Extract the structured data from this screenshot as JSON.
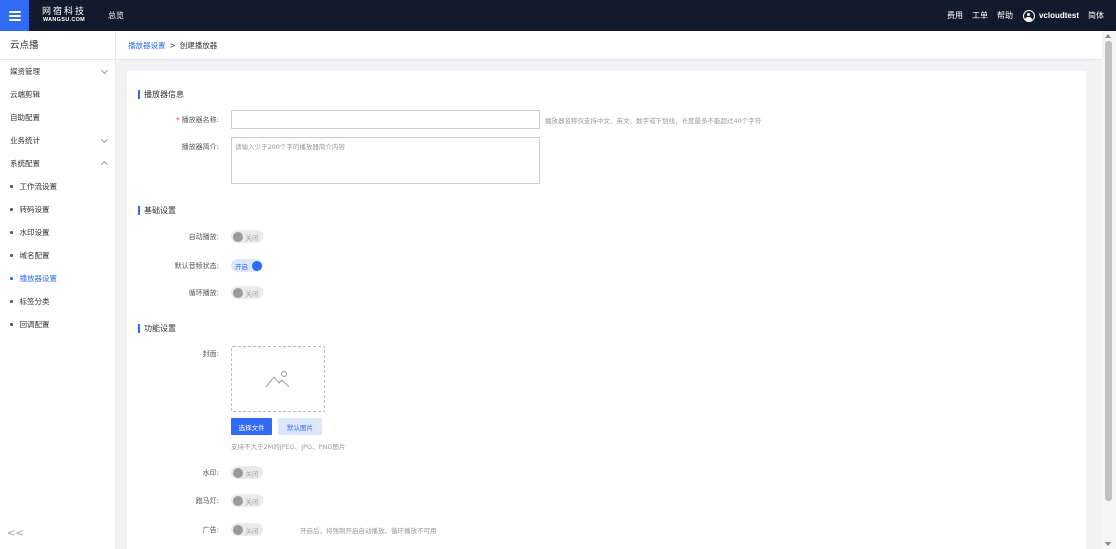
{
  "topbar": {
    "logo_cn": "网宿科技",
    "logo_en": "WANGSU.COM",
    "nav_overview": "总览",
    "links": [
      "费用",
      "工单",
      "帮助"
    ],
    "username": "vcloudtest",
    "language": "简体"
  },
  "sidebar": {
    "title": "云点播",
    "items": [
      {
        "label": "媒资管理",
        "expandable": true,
        "expanded": false
      },
      {
        "label": "云端剪辑",
        "expandable": false
      },
      {
        "label": "自助配置",
        "expandable": false
      },
      {
        "label": "业务统计",
        "expandable": true,
        "expanded": false
      },
      {
        "label": "系统配置",
        "expandable": true,
        "expanded": true
      }
    ],
    "subitems": [
      {
        "label": "工作流设置",
        "active": false
      },
      {
        "label": "转码设置",
        "active": false
      },
      {
        "label": "水印设置",
        "active": false
      },
      {
        "label": "域名配置",
        "active": false
      },
      {
        "label": "播放器设置",
        "active": true
      },
      {
        "label": "标签分类",
        "active": false
      },
      {
        "label": "回调配置",
        "active": false
      }
    ],
    "collapse_symbol": "<<"
  },
  "breadcrumb": {
    "parent": "播放器设置",
    "separator": ">",
    "current": "创建播放器"
  },
  "form": {
    "section_info": "播放器信息",
    "name_label": "播放器名称:",
    "name_required_mark": "*",
    "name_value": "",
    "name_hint": "播放器名称仅支持中文、英文、数字或下划线，长度最多不能超过40个字符",
    "desc_label": "播放器简介:",
    "desc_placeholder": "请输入少于200个字的播放器简介内容",
    "section_basic": "基础设置",
    "autoplay_label": "自动播放:",
    "autoplay_state": "关闭",
    "volume_label": "默认音频状态:",
    "volume_state": "开启",
    "loop_label": "循环播放:",
    "loop_state": "关闭",
    "section_function": "功能设置",
    "cover_label": "封面:",
    "select_file_button": "选择文件",
    "default_image_button": "默认图片",
    "upload_hint": "支持不大于2M的JPEG、JPG、PNG图片",
    "watermark_label": "水印:",
    "watermark_state": "关闭",
    "marquee_label": "跑马灯:",
    "marquee_state": "关闭",
    "ad_label": "广告:",
    "ad_state": "关闭",
    "ad_hint": "开启后，将强制开启自动播放，循环播放不可用"
  },
  "colors": {
    "accent": "#2f6bf5",
    "topbar": "#121a2e"
  }
}
